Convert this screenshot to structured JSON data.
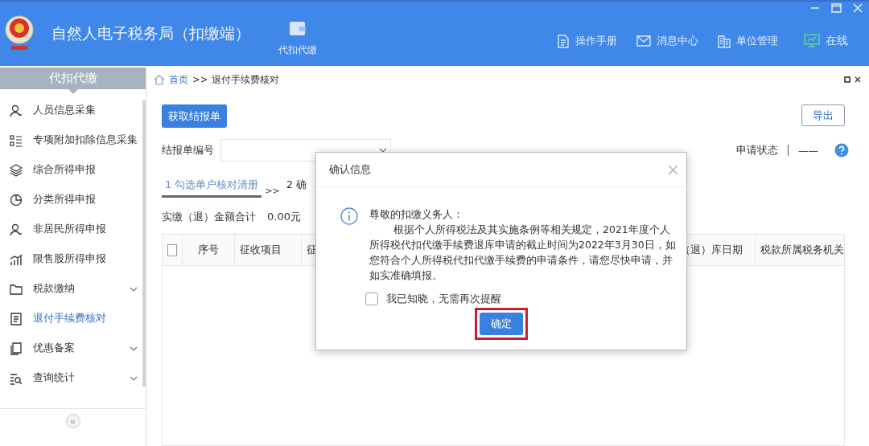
{
  "header": {
    "title": "自然人电子税务局（扣缴端）",
    "module_tab": "代扣代缴",
    "links": [
      {
        "label": "操作手册",
        "kind": "manual"
      },
      {
        "label": "消息中心",
        "kind": "message"
      },
      {
        "label": "单位管理",
        "kind": "unit"
      },
      {
        "label": "在线",
        "kind": "online"
      }
    ]
  },
  "sidebar": {
    "title": "代扣代缴",
    "items": [
      {
        "label": "人员信息采集",
        "kind": "person",
        "selected": false,
        "has_children": false
      },
      {
        "label": "专项附加扣除信息采集",
        "kind": "list",
        "selected": false,
        "has_children": false
      },
      {
        "label": "综合所得申报",
        "kind": "layers",
        "selected": false,
        "has_children": false
      },
      {
        "label": "分类所得申报",
        "kind": "pie",
        "selected": false,
        "has_children": false
      },
      {
        "label": "非居民所得申报",
        "kind": "person",
        "selected": false,
        "has_children": false
      },
      {
        "label": "限售股所得申报",
        "kind": "bars",
        "selected": false,
        "has_children": false
      },
      {
        "label": "税款缴纳",
        "kind": "folder",
        "selected": false,
        "has_children": true
      },
      {
        "label": "退付手续费核对",
        "kind": "doc",
        "selected": true,
        "has_children": false
      },
      {
        "label": "优惠备案",
        "kind": "copy",
        "selected": false,
        "has_children": true
      },
      {
        "label": "查询统计",
        "kind": "search",
        "selected": false,
        "has_children": true
      }
    ],
    "collapse": "«"
  },
  "breadcrumb": {
    "home": "首页",
    "separator": ">>",
    "current": "退付手续费核对"
  },
  "actions": {
    "fetch_button": "获取结报单",
    "export_button": "导出"
  },
  "filter": {
    "label": "结报单编号",
    "status_label": "申请状态",
    "status_value": "——"
  },
  "steps": [
    {
      "label": "1 勾选单户核对清册",
      "selected": true
    },
    {
      "label": "2 确",
      "selected": false
    }
  ],
  "step_separator": ">>",
  "summary": {
    "label": "实缴（退）金额合计",
    "value": "0.00元"
  },
  "table": {
    "select_all_checked": false,
    "columns": [
      "序号",
      "征收项目",
      "征",
      "（退）库日期",
      "税款所属税务机关"
    ]
  },
  "dialog": {
    "title": "确认信息",
    "greeting": "尊敬的扣缴义务人：",
    "body": "根据个人所得税法及其实施条例等相关规定，2021年度个人所得税代扣代缴手续费退库申请的截止时间为2022年3月30日，如您符合个人所得税代扣代缴手续费的申请条件，请您尽快申请，并如实准确填报。",
    "checkbox": {
      "label": "我已知晓，无需再次提醒",
      "checked": false
    },
    "confirm_button": "确定",
    "highlighted": true
  }
}
